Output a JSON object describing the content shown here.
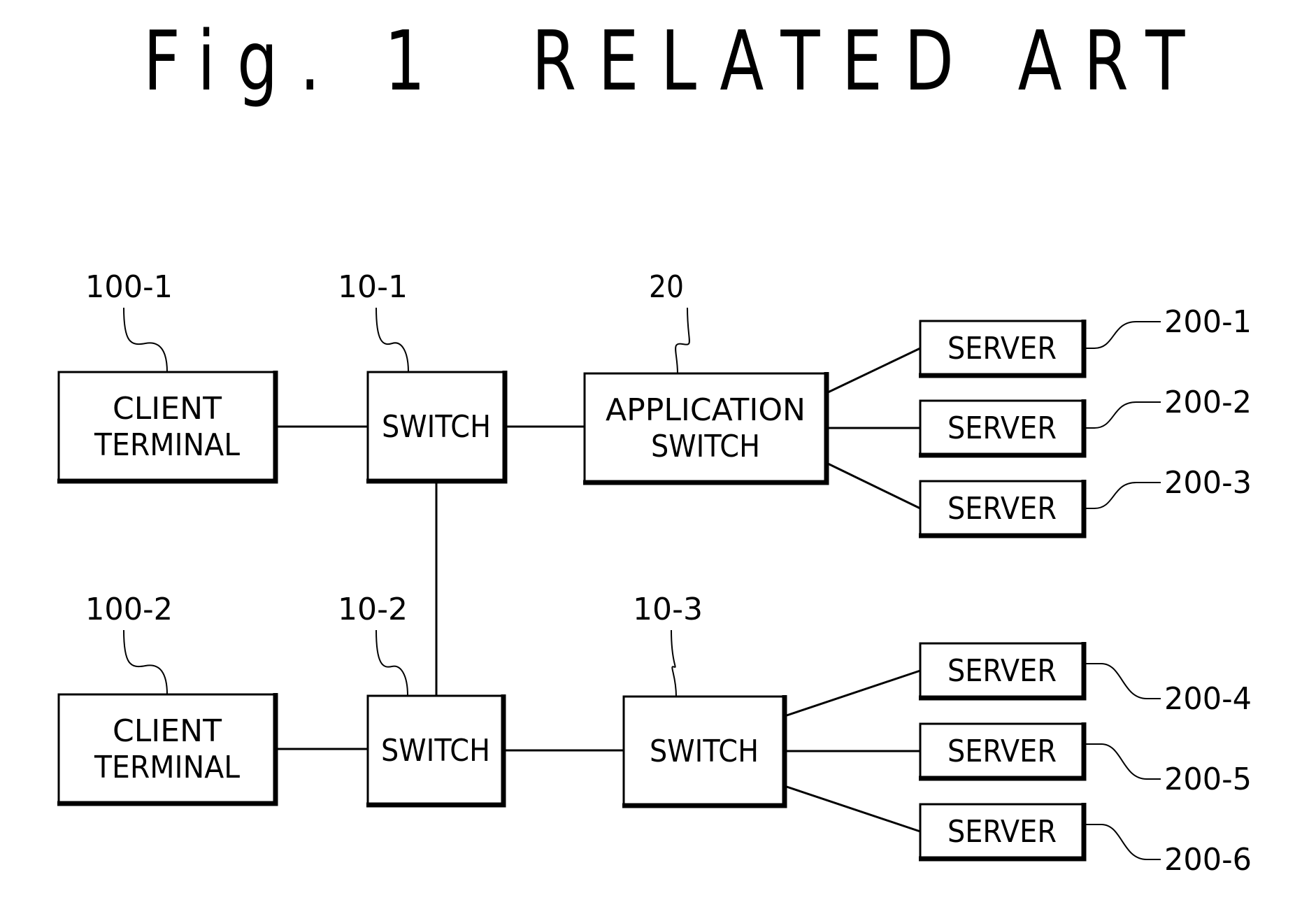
{
  "figure": {
    "title": "Fig. 1  RELATED ART"
  },
  "nodes": [
    {
      "id": "client-1",
      "ref": "100-1",
      "lines": [
        "CLIENT",
        "TERMINAL"
      ]
    },
    {
      "id": "switch-1",
      "ref": "10-1",
      "lines": [
        "SWITCH"
      ]
    },
    {
      "id": "app-switch",
      "ref": "20",
      "lines": [
        "APPLICATION",
        "SWITCH"
      ]
    },
    {
      "id": "server-1",
      "ref": "200-1",
      "lines": [
        "SERVER"
      ]
    },
    {
      "id": "server-2",
      "ref": "200-2",
      "lines": [
        "SERVER"
      ]
    },
    {
      "id": "server-3",
      "ref": "200-3",
      "lines": [
        "SERVER"
      ]
    },
    {
      "id": "client-2",
      "ref": "100-2",
      "lines": [
        "CLIENT",
        "TERMINAL"
      ]
    },
    {
      "id": "switch-2",
      "ref": "10-2",
      "lines": [
        "SWITCH"
      ]
    },
    {
      "id": "switch-3",
      "ref": "10-3",
      "lines": [
        "SWITCH"
      ]
    },
    {
      "id": "server-4",
      "ref": "200-4",
      "lines": [
        "SERVER"
      ]
    },
    {
      "id": "server-5",
      "ref": "200-5",
      "lines": [
        "SERVER"
      ]
    },
    {
      "id": "server-6",
      "ref": "200-6",
      "lines": [
        "SERVER"
      ]
    }
  ],
  "edges": [
    [
      "client-1",
      "switch-1"
    ],
    [
      "switch-1",
      "app-switch"
    ],
    [
      "app-switch",
      "server-1"
    ],
    [
      "app-switch",
      "server-2"
    ],
    [
      "app-switch",
      "server-3"
    ],
    [
      "switch-1",
      "switch-2"
    ],
    [
      "client-2",
      "switch-2"
    ],
    [
      "switch-2",
      "switch-3"
    ],
    [
      "switch-3",
      "server-4"
    ],
    [
      "switch-3",
      "server-5"
    ],
    [
      "switch-3",
      "server-6"
    ]
  ]
}
